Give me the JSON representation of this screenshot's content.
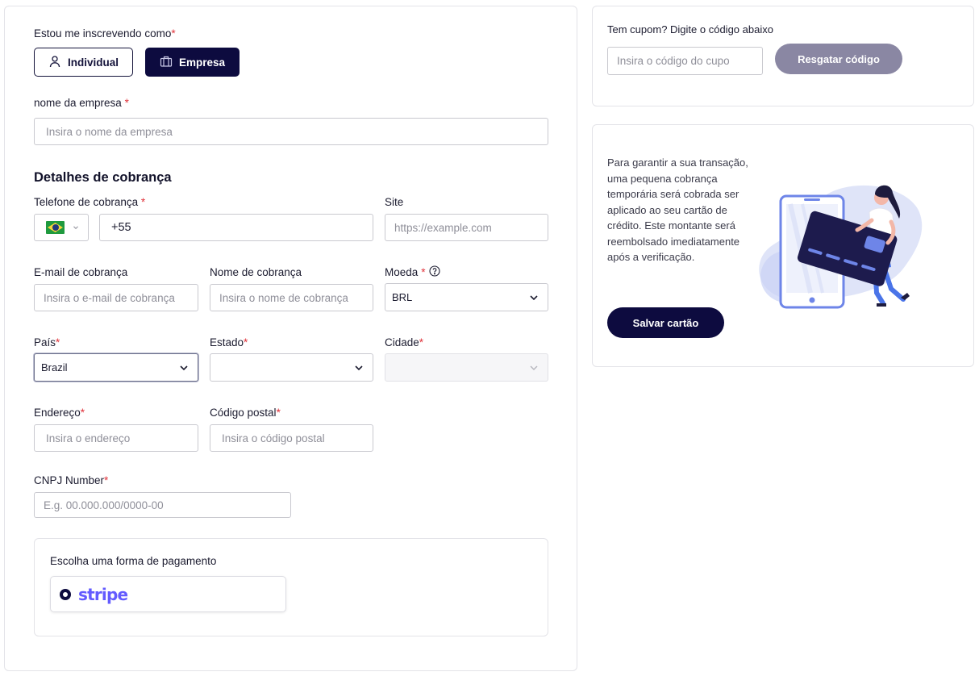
{
  "signup": {
    "label": "Estou me inscrevendo como",
    "required_mark": "*",
    "options": [
      {
        "label": "Individual",
        "icon": "user-icon",
        "selected": false
      },
      {
        "label": "Empresa",
        "icon": "briefcase-icon",
        "selected": true
      }
    ]
  },
  "company": {
    "label": "nome da empresa",
    "required_mark": " *",
    "placeholder": "Insira o nome da empresa"
  },
  "billing": {
    "title": "Detalhes de cobrança",
    "phone": {
      "label": "Telefone de cobrança",
      "required_mark": " *",
      "value": "+55",
      "flag_icon": "brazil-flag-icon"
    },
    "site": {
      "label": "Site",
      "placeholder": "https://example.com"
    },
    "email": {
      "label": "E-mail de cobrança",
      "placeholder": "Insira o e-mail de cobrança"
    },
    "name": {
      "label": "Nome de cobrança",
      "placeholder": "Insira o nome de cobrança"
    },
    "currency": {
      "label": "Moeda",
      "required_mark": "*",
      "value": "BRL"
    },
    "country": {
      "label": "País",
      "required_mark": "*",
      "value": "Brazil"
    },
    "state": {
      "label": "Estado",
      "required_mark": "*",
      "value": ""
    },
    "city": {
      "label": "Cidade",
      "required_mark": "*",
      "value": ""
    },
    "address": {
      "label": "Endereço",
      "required_mark": "*",
      "placeholder": "Insira o endereço"
    },
    "postal": {
      "label": "Código postal",
      "required_mark": "*",
      "placeholder": "Insira o código postal"
    },
    "cnpj": {
      "label": "CNPJ Number",
      "required_mark": "*",
      "placeholder": "E.g. 00.000.000/0000-00"
    }
  },
  "payment": {
    "label": "Escolha uma forma de pagamento",
    "option": "stripe"
  },
  "coupon": {
    "label": "Tem cupom? Digite o código abaixo",
    "placeholder": "Insira o código do cupo",
    "button": "Resgatar código"
  },
  "card": {
    "text": "Para garantir a sua transação, uma pequena cobrança temporária será cobrada ser aplicado ao seu cartão de crédito. Este montante será reembolsado imediatamente após a verificação.",
    "button": "Salvar cartão"
  },
  "colors": {
    "primary": "#0d0b3f",
    "muted_button": "#8a87a3",
    "required": "#e0323a",
    "stripe": "#635bff"
  }
}
